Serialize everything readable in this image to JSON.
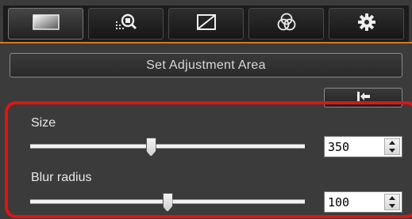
{
  "tabs": [
    {
      "icon": "image-icon",
      "active": true
    },
    {
      "icon": "magnifier-icon",
      "active": false
    },
    {
      "icon": "tone-curve-icon",
      "active": false
    },
    {
      "icon": "color-circles-icon",
      "active": false
    },
    {
      "icon": "gear-icon",
      "active": false
    }
  ],
  "set_area_button": {
    "label": "Set Adjustment Area"
  },
  "reset_button": {
    "icon": "reset-icon"
  },
  "size": {
    "label": "Size",
    "value": "350",
    "slider_fraction": 0.44
  },
  "blur_radius": {
    "label": "Blur radius",
    "value": "100",
    "slider_fraction": 0.5
  },
  "colors": {
    "accent": "#d67a1f",
    "highlight": "#e01414",
    "background": "#3b3b3b"
  }
}
